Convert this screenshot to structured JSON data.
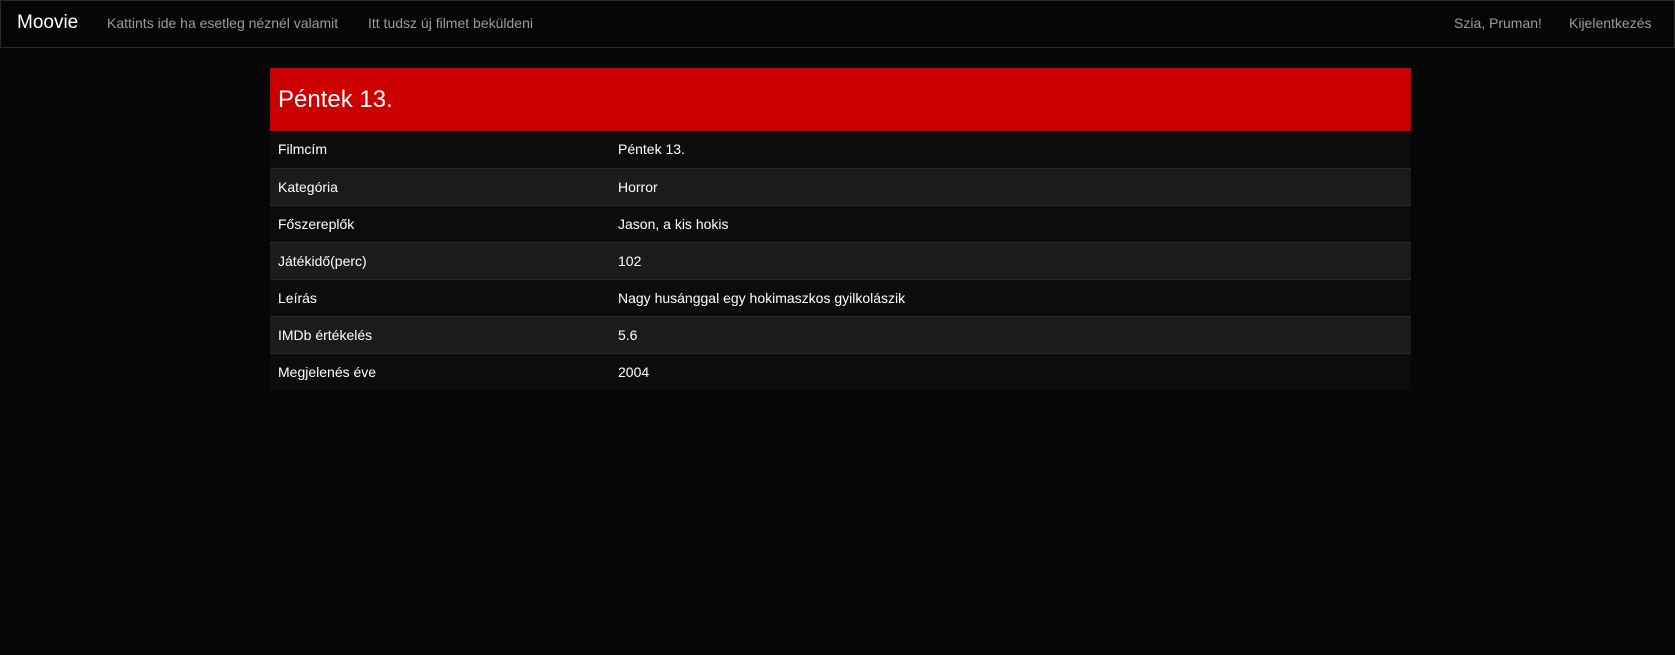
{
  "navbar": {
    "brand": "Moovie",
    "left_links": [
      "Kattints ide ha esetleg néznél valamit",
      "Itt tudsz új filmet beküldeni"
    ],
    "greeting": "Szia, Pruman!",
    "logout": "Kijelentkezés"
  },
  "movie": {
    "title": "Péntek 13.",
    "rows": [
      {
        "label": "Filmcím",
        "value": "Péntek 13."
      },
      {
        "label": "Kategória",
        "value": "Horror"
      },
      {
        "label": "Főszereplők",
        "value": "Jason, a kis hokis"
      },
      {
        "label": "Játékidő(perc)",
        "value": "102"
      },
      {
        "label": "Leírás",
        "value": "Nagy husánggal egy hokimaszkos gyilkolászik"
      },
      {
        "label": "IMDb értékelés",
        "value": "5.6"
      },
      {
        "label": "Megjelenés éve",
        "value": "2004"
      }
    ]
  },
  "colors": {
    "header_red": "#cc0000",
    "background": "#060606"
  }
}
